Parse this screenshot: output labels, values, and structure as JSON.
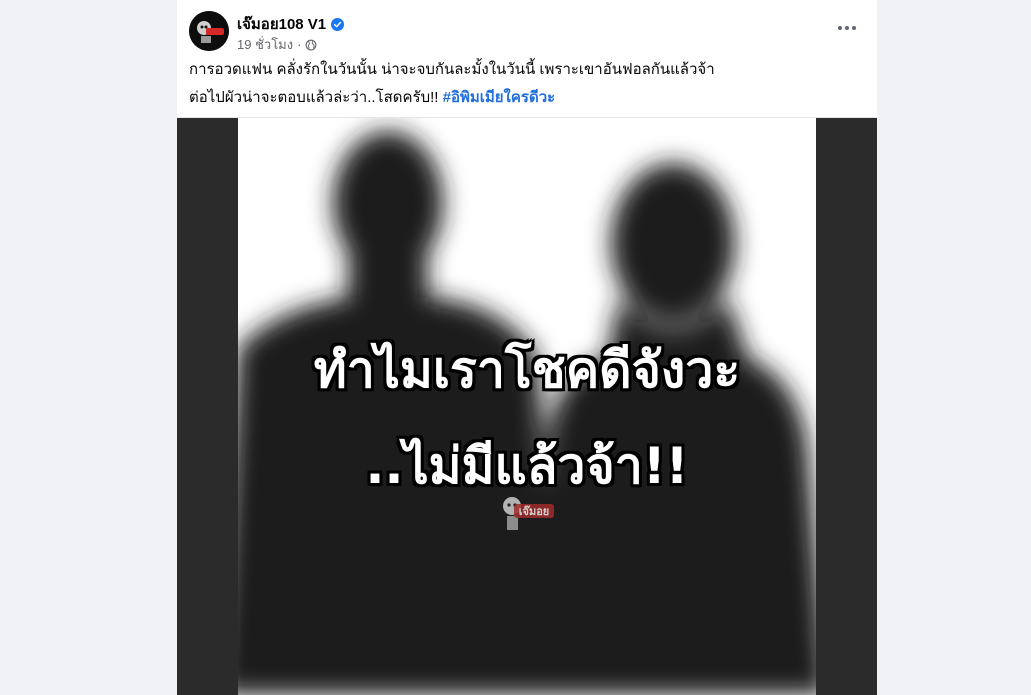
{
  "post": {
    "author": "เจ๊มอย108 V1",
    "time": "19 ชั่วโมง",
    "separator": "·",
    "text_line1": "การอวดแฟน คลั่งรักในวันนั้น น่าจะจบกันละมั้งในวันนี้ เพราะเขาอันฟอลกันแล้วจ้า",
    "text_line2": "ต่อไปผัวน่าจะตอบแล้วล่ะว่า..โสดครับ!! ",
    "hashtag": "#อิพิมเมียใครดีวะ"
  },
  "image": {
    "overlay_line1": "ทำไมเราโชคดีจังวะ",
    "overlay_line2": "..ไม่มีแล้วจ้า!!",
    "watermark": "เจ๊มอย"
  },
  "icons": {
    "verified": "verified-badge-icon",
    "audience": "globe-icon",
    "menu": "more-options-icon"
  },
  "colors": {
    "link": "#216fdb",
    "verified": "#1877f2",
    "background": "#f0f2f5"
  }
}
